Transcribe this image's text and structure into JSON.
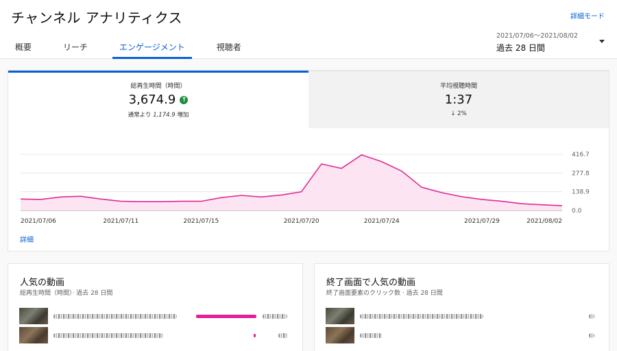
{
  "header": {
    "title": "チャンネル アナリティクス",
    "advanced_mode": "詳細モード",
    "tabs": [
      {
        "label": "概要"
      },
      {
        "label": "リーチ"
      },
      {
        "label": "エンゲージメント"
      },
      {
        "label": "視聴者"
      }
    ],
    "active_tab": 2,
    "date_range": "2021/07/06～2021/08/02",
    "date_period": "過去 28 日間"
  },
  "metrics": [
    {
      "label": "総再生時間（時間）",
      "value": "3,674.9",
      "sub_prefix": "通常より",
      "sub_value": "1,174.9",
      "sub_suffix": "増加"
    },
    {
      "label": "平均視聴時間",
      "value": "1:37",
      "sub": "↓ 2%"
    }
  ],
  "detail_link": "詳細",
  "chart_data": {
    "type": "area",
    "x": [
      "2021/07/06",
      "2021/07/07",
      "2021/07/08",
      "2021/07/09",
      "2021/07/10",
      "2021/07/11",
      "2021/07/12",
      "2021/07/13",
      "2021/07/14",
      "2021/07/15",
      "2021/07/16",
      "2021/07/17",
      "2021/07/18",
      "2021/07/19",
      "2021/07/20",
      "2021/07/21",
      "2021/07/22",
      "2021/07/23",
      "2021/07/24",
      "2021/07/25",
      "2021/07/26",
      "2021/07/27",
      "2021/07/28",
      "2021/07/29",
      "2021/07/30",
      "2021/07/31",
      "2021/08/01",
      "2021/08/02"
    ],
    "values": [
      85,
      82,
      100,
      105,
      85,
      68,
      65,
      65,
      68,
      68,
      95,
      112,
      100,
      115,
      138,
      345,
      312,
      412,
      362,
      292,
      172,
      132,
      102,
      82,
      68,
      50,
      42,
      35
    ],
    "x_tick_labels": [
      "2021/07/06",
      "2021/07/11",
      "2021/07/15",
      "2021/07/20",
      "2021/07/24",
      "2021/07/29",
      "2021/08/02"
    ],
    "y_ticks": [
      "0.0",
      "138.9",
      "277.8",
      "416.7"
    ],
    "ylim": [
      0,
      416.7
    ],
    "color": "#de2c92",
    "fill": "#fce4f2"
  },
  "bottom_cards": [
    {
      "title": "人気の動画",
      "subtitle": "総再生時間（時間）· 過去 28 日間"
    },
    {
      "title": "終了画面で人気の動画",
      "subtitle": "終了画面要素のクリック数 · 過去 28 日間"
    }
  ]
}
